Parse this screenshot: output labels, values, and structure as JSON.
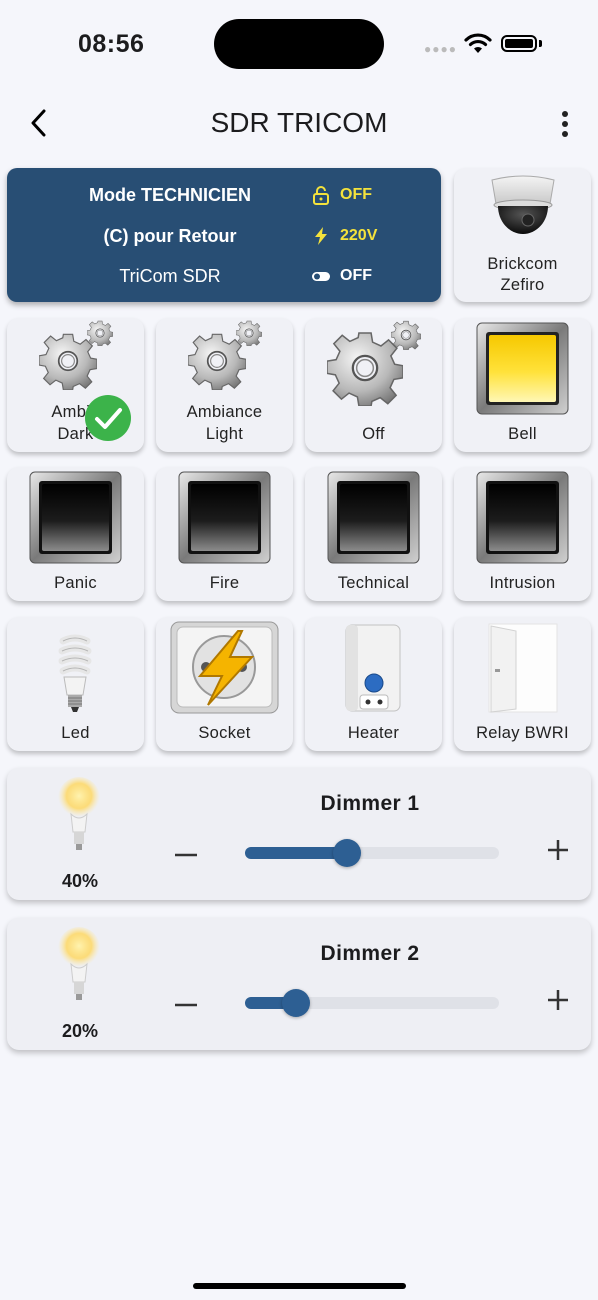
{
  "status": {
    "time": "08:56"
  },
  "header": {
    "title": "SDR TRICOM"
  },
  "info": {
    "mode_label": "Mode TECHNICIEN",
    "mode_value": "OFF",
    "return_label": "(C) pour Retour",
    "power_value": "220V",
    "device_label": "TriCom SDR",
    "toggle_value": "OFF",
    "accent_color": "#f4e23c",
    "bg_color": "#284e74",
    "lock_icon": "lock-open-icon",
    "power_icon": "lightning-icon",
    "toggle_icon": "toggle-icon"
  },
  "camera": {
    "label_line1": "Brickcom",
    "label_line2": "Zefiro",
    "icon": "camera-dome-icon"
  },
  "tiles": {
    "ambiance_dark": {
      "line1": "Ambia",
      "line2": "Dark",
      "icon": "gears-icon",
      "active": true
    },
    "ambiance_light": {
      "line1": "Ambiance",
      "line2": "Light",
      "icon": "gears-icon"
    },
    "off": {
      "label": "Off",
      "icon": "gears-icon"
    },
    "bell": {
      "label": "Bell",
      "icon": "yellow-square-button-icon"
    },
    "panic": {
      "label": "Panic",
      "icon": "dark-square-button-icon"
    },
    "fire": {
      "label": "Fire",
      "icon": "dark-square-button-icon"
    },
    "technical": {
      "label": "Technical",
      "icon": "dark-square-button-icon"
    },
    "intrusion": {
      "label": "Intrusion",
      "icon": "dark-square-button-icon"
    },
    "led": {
      "label": "Led",
      "icon": "cfl-bulb-icon"
    },
    "socket": {
      "label": "Socket",
      "icon": "socket-lightning-icon"
    },
    "heater": {
      "label": "Heater",
      "icon": "water-heater-icon"
    },
    "relay": {
      "label": "Relay BWRI",
      "icon": "door-icon"
    }
  },
  "dimmers": [
    {
      "title": "Dimmer 1",
      "percent_label": "40%",
      "value": 0.4
    },
    {
      "title": "Dimmer 2",
      "percent_label": "20%",
      "value": 0.2
    }
  ]
}
